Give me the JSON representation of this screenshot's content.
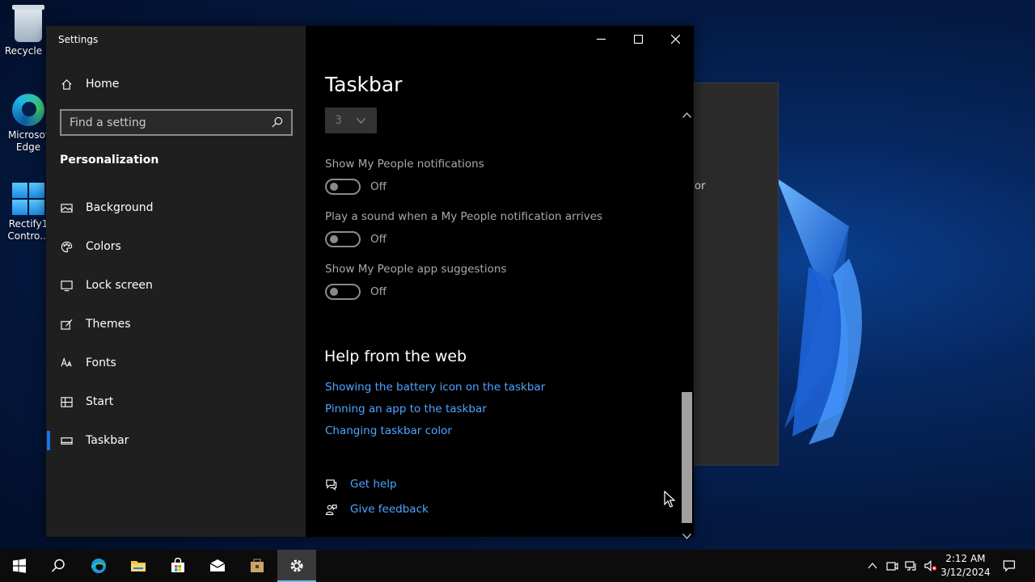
{
  "desktop": {
    "icons": [
      {
        "label_line1": "Recycle B"
      },
      {
        "label_line1": "Microsof",
        "label_line2": "Edge"
      },
      {
        "label_line1": "Rectify1",
        "label_line2": "Contro..."
      }
    ]
  },
  "background_window": {
    "fragment_text": "or"
  },
  "window": {
    "title": "Settings",
    "caption": {
      "minimize": "minimize-icon",
      "maximize": "maximize-icon",
      "close": "close-icon"
    }
  },
  "sidebar": {
    "home_label": "Home",
    "search": {
      "placeholder": "Find a setting",
      "value": ""
    },
    "section": "Personalization",
    "items": [
      {
        "label": "Background",
        "icon": "picture-icon"
      },
      {
        "label": "Colors",
        "icon": "palette-icon"
      },
      {
        "label": "Lock screen",
        "icon": "monitor-icon"
      },
      {
        "label": "Themes",
        "icon": "brush-icon"
      },
      {
        "label": "Fonts",
        "icon": "font-icon"
      },
      {
        "label": "Start",
        "icon": "start-icon"
      },
      {
        "label": "Taskbar",
        "icon": "taskbar-icon",
        "active": true
      }
    ]
  },
  "main": {
    "title": "Taskbar",
    "combo_value": "3",
    "settings": [
      {
        "label": "Show My People notifications",
        "state": "Off"
      },
      {
        "label": "Play a sound when a My People notification arrives",
        "state": "Off"
      },
      {
        "label": "Show My People app suggestions",
        "state": "Off"
      }
    ],
    "help_title": "Help from the web",
    "help_links": [
      "Showing the battery icon on the taskbar",
      "Pinning an app to the taskbar",
      "Changing taskbar color"
    ],
    "get_help": "Get help",
    "give_feedback": "Give feedback"
  },
  "taskbar": {
    "clock_time": "2:12 AM",
    "clock_date": "3/12/2024",
    "accent": "#76b9ed"
  },
  "colors": {
    "link": "#4ea5ff",
    "accent": "#1a73e8"
  }
}
